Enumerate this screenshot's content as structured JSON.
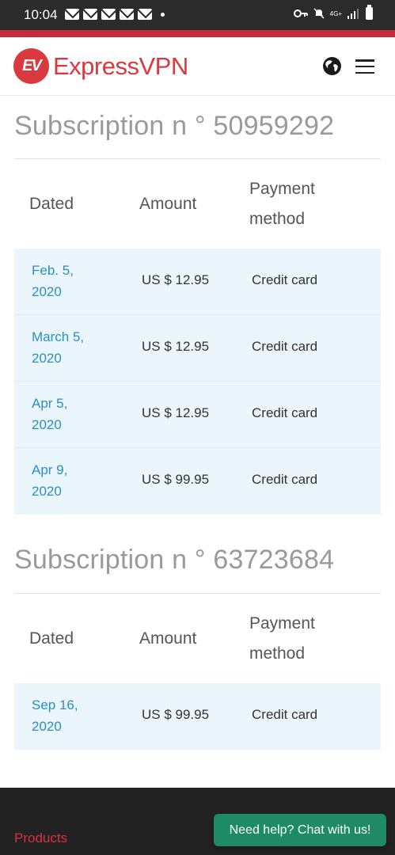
{
  "status_bar": {
    "time": "10:04",
    "network": "4G+"
  },
  "header": {
    "logo_mark": "EV",
    "brand": "ExpressVPN",
    "brand_color": "#da3940",
    "accent_line_color": "#c8283a"
  },
  "subscriptions": [
    {
      "title": "Subscription n ° 50959292",
      "columns": {
        "dated": "Dated",
        "amount": "Amount",
        "payment_line1": "Payment",
        "payment_line2": "method"
      },
      "rows": [
        {
          "date_line1": "Feb. 5,",
          "date_line2": "2020",
          "amount": "US $ 12.95",
          "method": "Credit card"
        },
        {
          "date_line1": "March 5,",
          "date_line2": "2020",
          "amount": "US $ 12.95",
          "method": "Credit card"
        },
        {
          "date_line1": "Apr 5,",
          "date_line2": "2020",
          "amount": "US $ 12.95",
          "method": "Credit card"
        },
        {
          "date_line1": "Apr 9,",
          "date_line2": "2020",
          "amount": "US $ 99.95",
          "method": "Credit card"
        }
      ]
    },
    {
      "title": "Subscription n ° 63723684",
      "columns": {
        "dated": "Dated",
        "amount": "Amount",
        "payment_line1": "Payment",
        "payment_line2": "method"
      },
      "rows": [
        {
          "date_line1": "Sep 16,",
          "date_line2": "2020",
          "amount": "US $ 99.95",
          "method": "Credit card"
        }
      ]
    }
  ],
  "footer": {
    "products_link": "Products",
    "chat_button": "Need help? Chat with us!",
    "chat_color": "#1f8a66"
  },
  "icons": [
    "globe-icon",
    "hamburger-menu-icon",
    "mail-icon",
    "key-icon",
    "mute-icon",
    "signal-icon",
    "battery-icon"
  ]
}
